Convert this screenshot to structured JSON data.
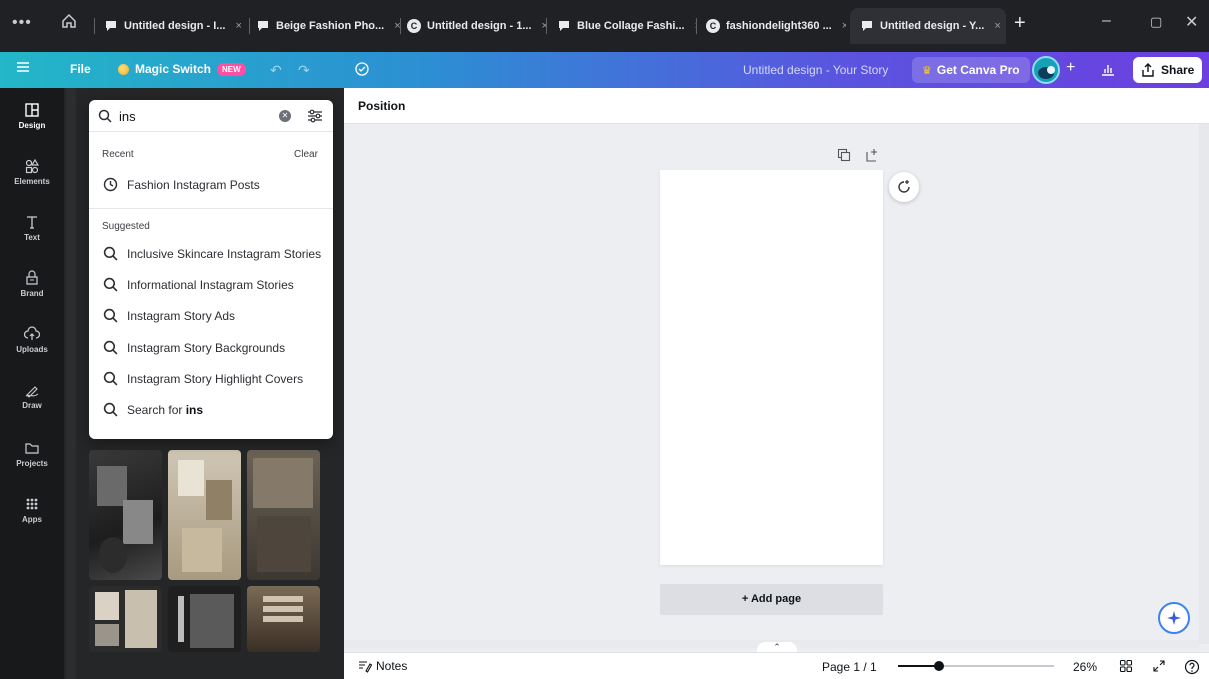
{
  "browser": {
    "tabs": [
      {
        "title": "Untitled design - I...",
        "favicon": "canva-chat-icon"
      },
      {
        "title": "Beige Fashion Pho...",
        "favicon": "canva-chat-icon"
      },
      {
        "title": "Untitled design - 1...",
        "favicon": "canva-c-icon"
      },
      {
        "title": "Blue Collage Fashi...",
        "favicon": "canva-chat-icon"
      },
      {
        "title": "fashiondelight360 ...",
        "favicon": "canva-c-icon"
      },
      {
        "title": "Untitled design - Y...",
        "favicon": "canva-chat-icon",
        "active": true
      }
    ],
    "new_tab": "+"
  },
  "toolbar": {
    "file": "File",
    "magic_switch": "Magic Switch",
    "new_badge": "NEW",
    "design_title": "Untitled design - Your Story",
    "get_pro": "Get Canva Pro",
    "plus": "+",
    "share": "Share"
  },
  "rail": {
    "items": [
      {
        "label": "Design",
        "icon": "design-icon"
      },
      {
        "label": "Elements",
        "icon": "elements-icon"
      },
      {
        "label": "Text",
        "icon": "text-icon"
      },
      {
        "label": "Brand",
        "icon": "brand-icon"
      },
      {
        "label": "Uploads",
        "icon": "uploads-icon"
      },
      {
        "label": "Draw",
        "icon": "draw-icon"
      },
      {
        "label": "Projects",
        "icon": "folder-icon"
      },
      {
        "label": "Apps",
        "icon": "apps-icon"
      }
    ]
  },
  "search": {
    "value": "ins",
    "recent_heading": "Recent",
    "clear_label": "Clear",
    "recent": [
      "Fashion Instagram Posts"
    ],
    "suggested_heading": "Suggested",
    "suggested": [
      "Inclusive Skincare Instagram Stories",
      "Informational Instagram Stories",
      "Instagram Story Ads",
      "Instagram Story Backgrounds",
      "Instagram Story Highlight Covers"
    ],
    "search_for_prefix": "Search for",
    "search_for_term": "ins"
  },
  "canvas": {
    "context_label": "Position",
    "add_page": "+ Add page"
  },
  "bottom": {
    "notes": "Notes",
    "page_indicator": "Page 1 / 1",
    "zoom": "26%",
    "zoom_fraction": 0.26
  },
  "colors": {
    "accent_purple": "#6c3fe0",
    "accent_teal": "#23b7c8",
    "rail_bg": "#18191b",
    "panel_bg": "#252627"
  }
}
